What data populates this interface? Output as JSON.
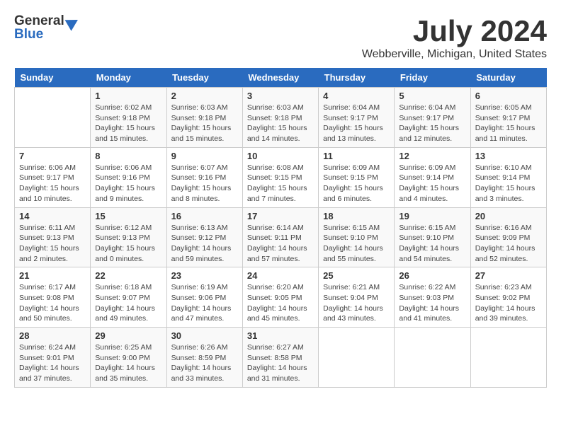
{
  "header": {
    "logo_general": "General",
    "logo_blue": "Blue",
    "month_title": "July 2024",
    "location": "Webberville, Michigan, United States"
  },
  "calendar": {
    "days_of_week": [
      "Sunday",
      "Monday",
      "Tuesday",
      "Wednesday",
      "Thursday",
      "Friday",
      "Saturday"
    ],
    "weeks": [
      [
        {
          "day": "",
          "info": ""
        },
        {
          "day": "1",
          "info": "Sunrise: 6:02 AM\nSunset: 9:18 PM\nDaylight: 15 hours\nand 15 minutes."
        },
        {
          "day": "2",
          "info": "Sunrise: 6:03 AM\nSunset: 9:18 PM\nDaylight: 15 hours\nand 15 minutes."
        },
        {
          "day": "3",
          "info": "Sunrise: 6:03 AM\nSunset: 9:18 PM\nDaylight: 15 hours\nand 14 minutes."
        },
        {
          "day": "4",
          "info": "Sunrise: 6:04 AM\nSunset: 9:17 PM\nDaylight: 15 hours\nand 13 minutes."
        },
        {
          "day": "5",
          "info": "Sunrise: 6:04 AM\nSunset: 9:17 PM\nDaylight: 15 hours\nand 12 minutes."
        },
        {
          "day": "6",
          "info": "Sunrise: 6:05 AM\nSunset: 9:17 PM\nDaylight: 15 hours\nand 11 minutes."
        }
      ],
      [
        {
          "day": "7",
          "info": "Sunrise: 6:06 AM\nSunset: 9:17 PM\nDaylight: 15 hours\nand 10 minutes."
        },
        {
          "day": "8",
          "info": "Sunrise: 6:06 AM\nSunset: 9:16 PM\nDaylight: 15 hours\nand 9 minutes."
        },
        {
          "day": "9",
          "info": "Sunrise: 6:07 AM\nSunset: 9:16 PM\nDaylight: 15 hours\nand 8 minutes."
        },
        {
          "day": "10",
          "info": "Sunrise: 6:08 AM\nSunset: 9:15 PM\nDaylight: 15 hours\nand 7 minutes."
        },
        {
          "day": "11",
          "info": "Sunrise: 6:09 AM\nSunset: 9:15 PM\nDaylight: 15 hours\nand 6 minutes."
        },
        {
          "day": "12",
          "info": "Sunrise: 6:09 AM\nSunset: 9:14 PM\nDaylight: 15 hours\nand 4 minutes."
        },
        {
          "day": "13",
          "info": "Sunrise: 6:10 AM\nSunset: 9:14 PM\nDaylight: 15 hours\nand 3 minutes."
        }
      ],
      [
        {
          "day": "14",
          "info": "Sunrise: 6:11 AM\nSunset: 9:13 PM\nDaylight: 15 hours\nand 2 minutes."
        },
        {
          "day": "15",
          "info": "Sunrise: 6:12 AM\nSunset: 9:13 PM\nDaylight: 15 hours\nand 0 minutes."
        },
        {
          "day": "16",
          "info": "Sunrise: 6:13 AM\nSunset: 9:12 PM\nDaylight: 14 hours\nand 59 minutes."
        },
        {
          "day": "17",
          "info": "Sunrise: 6:14 AM\nSunset: 9:11 PM\nDaylight: 14 hours\nand 57 minutes."
        },
        {
          "day": "18",
          "info": "Sunrise: 6:15 AM\nSunset: 9:10 PM\nDaylight: 14 hours\nand 55 minutes."
        },
        {
          "day": "19",
          "info": "Sunrise: 6:15 AM\nSunset: 9:10 PM\nDaylight: 14 hours\nand 54 minutes."
        },
        {
          "day": "20",
          "info": "Sunrise: 6:16 AM\nSunset: 9:09 PM\nDaylight: 14 hours\nand 52 minutes."
        }
      ],
      [
        {
          "day": "21",
          "info": "Sunrise: 6:17 AM\nSunset: 9:08 PM\nDaylight: 14 hours\nand 50 minutes."
        },
        {
          "day": "22",
          "info": "Sunrise: 6:18 AM\nSunset: 9:07 PM\nDaylight: 14 hours\nand 49 minutes."
        },
        {
          "day": "23",
          "info": "Sunrise: 6:19 AM\nSunset: 9:06 PM\nDaylight: 14 hours\nand 47 minutes."
        },
        {
          "day": "24",
          "info": "Sunrise: 6:20 AM\nSunset: 9:05 PM\nDaylight: 14 hours\nand 45 minutes."
        },
        {
          "day": "25",
          "info": "Sunrise: 6:21 AM\nSunset: 9:04 PM\nDaylight: 14 hours\nand 43 minutes."
        },
        {
          "day": "26",
          "info": "Sunrise: 6:22 AM\nSunset: 9:03 PM\nDaylight: 14 hours\nand 41 minutes."
        },
        {
          "day": "27",
          "info": "Sunrise: 6:23 AM\nSunset: 9:02 PM\nDaylight: 14 hours\nand 39 minutes."
        }
      ],
      [
        {
          "day": "28",
          "info": "Sunrise: 6:24 AM\nSunset: 9:01 PM\nDaylight: 14 hours\nand 37 minutes."
        },
        {
          "day": "29",
          "info": "Sunrise: 6:25 AM\nSunset: 9:00 PM\nDaylight: 14 hours\nand 35 minutes."
        },
        {
          "day": "30",
          "info": "Sunrise: 6:26 AM\nSunset: 8:59 PM\nDaylight: 14 hours\nand 33 minutes."
        },
        {
          "day": "31",
          "info": "Sunrise: 6:27 AM\nSunset: 8:58 PM\nDaylight: 14 hours\nand 31 minutes."
        },
        {
          "day": "",
          "info": ""
        },
        {
          "day": "",
          "info": ""
        },
        {
          "day": "",
          "info": ""
        }
      ]
    ]
  }
}
